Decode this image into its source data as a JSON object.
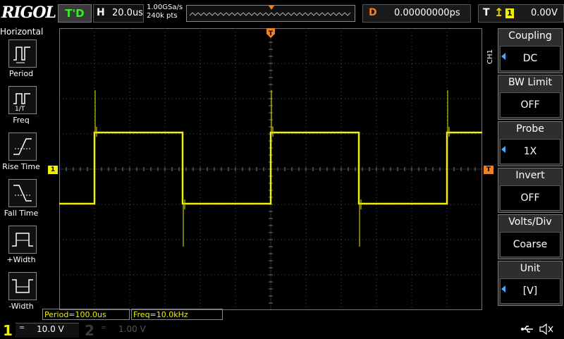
{
  "header": {
    "logo": "RIGOL",
    "run_status": "T'D",
    "timebase_label": "H",
    "timebase_value": "20.0us",
    "sample_rate": "1.00GSa/s",
    "memory_depth": "240k pts",
    "delay_label": "D",
    "delay_value": "0.00000000ps",
    "trigger_label": "T",
    "trigger_source": "1",
    "trigger_level": "0.00V"
  },
  "left_menu": {
    "title": "Horizontal",
    "items": [
      {
        "label": "Period",
        "icon": "period-icon"
      },
      {
        "label": "Freq",
        "icon": "freq-icon"
      },
      {
        "label": "Rise Time",
        "icon": "rise-time-icon"
      },
      {
        "label": "Fall Time",
        "icon": "fall-time-icon"
      },
      {
        "label": "+Width",
        "icon": "positive-width-icon"
      },
      {
        "label": "-Width",
        "icon": "negative-width-icon"
      }
    ]
  },
  "right_menu": {
    "channel_tab": "CH1",
    "items": [
      {
        "title": "Coupling",
        "value": "DC",
        "has_arrow": true
      },
      {
        "title": "BW Limit",
        "value": "OFF",
        "has_arrow": false
      },
      {
        "title": "Probe",
        "value": "1X",
        "has_arrow": true
      },
      {
        "title": "Invert",
        "value": "OFF",
        "has_arrow": false
      },
      {
        "title": "Volts/Div",
        "value": "Coarse",
        "has_arrow": false
      },
      {
        "title": "Unit",
        "value": "[V]",
        "has_arrow": true
      }
    ]
  },
  "measurements": {
    "period": "Period=100.0us",
    "freq": "Freq=10.0kHz"
  },
  "channels": {
    "ch1_number": "1",
    "ch1_scale": "10.0 V",
    "ch2_number": "2",
    "ch2_scale": "1.00 V"
  },
  "markers": {
    "ch1_marker": "1",
    "trigger_marker": "T"
  },
  "colors": {
    "ch1": "#f0f000",
    "trigger": "#f08020",
    "run_status": "#34f020",
    "grid": "#555555"
  }
}
